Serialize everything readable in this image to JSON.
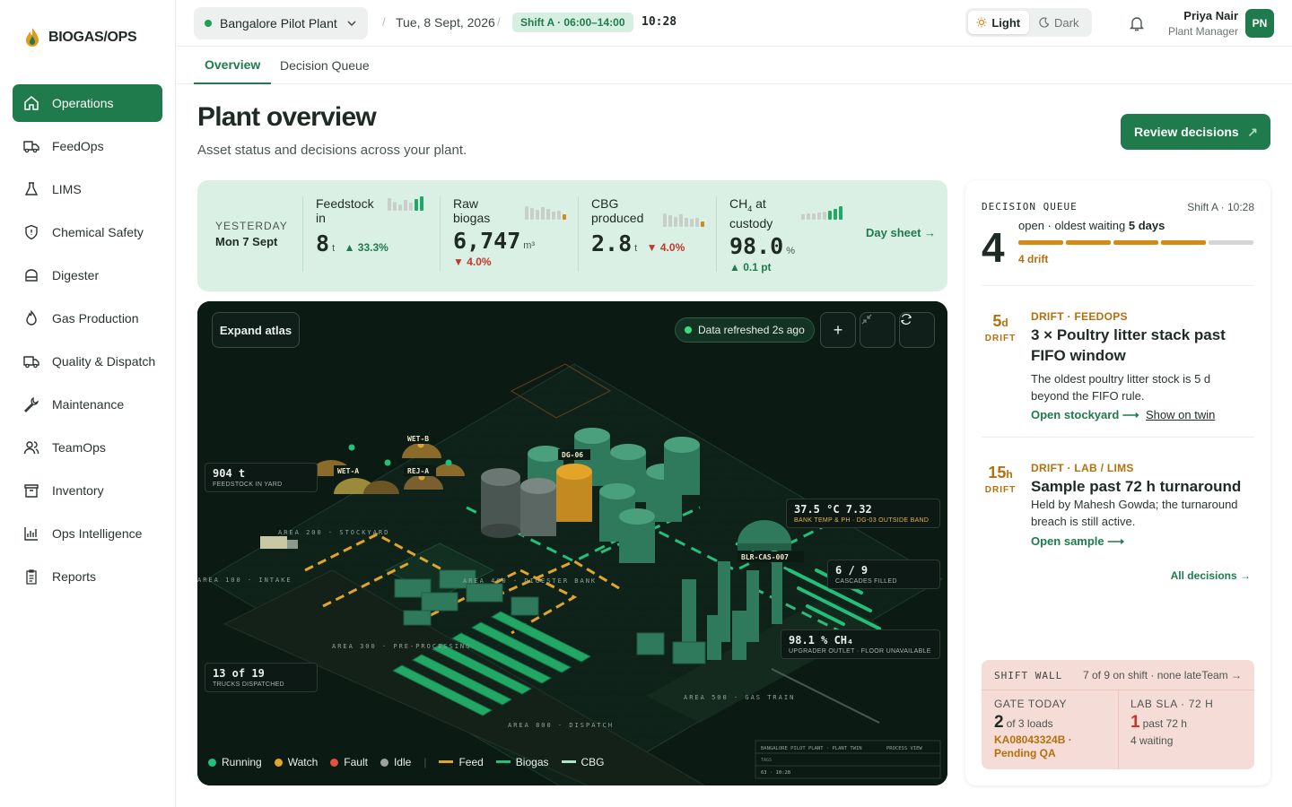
{
  "brand": {
    "name": "BIOGAS/OPS"
  },
  "sidebar": {
    "items": [
      {
        "label": "Operations",
        "icon": "home-icon"
      },
      {
        "label": "FeedOps",
        "icon": "truck-icon"
      },
      {
        "label": "LIMS",
        "icon": "flask-icon"
      },
      {
        "label": "Chemical Safety",
        "icon": "shield-icon"
      },
      {
        "label": "Digester",
        "icon": "tank-icon"
      },
      {
        "label": "Gas Production",
        "icon": "flame-icon"
      },
      {
        "label": "Quality & Dispatch",
        "icon": "delivery-truck-icon"
      },
      {
        "label": "Maintenance",
        "icon": "wrench-icon"
      },
      {
        "label": "TeamOps",
        "icon": "users-icon"
      },
      {
        "label": "Inventory",
        "icon": "archive-icon"
      },
      {
        "label": "Ops Intelligence",
        "icon": "chart-icon"
      },
      {
        "label": "Reports",
        "icon": "clipboard-icon"
      }
    ]
  },
  "topbar": {
    "plant": "Bangalore Pilot Plant",
    "date": "Tue, 8 Sept, 2026",
    "shift": "Shift A · 06:00–14:00",
    "clock": "10:28",
    "theme_light": "Light",
    "theme_dark": "Dark",
    "user_name": "Priya Nair",
    "user_role": "Plant Manager",
    "user_initials": "PN"
  },
  "tabs": [
    "Overview",
    "Decision Queue"
  ],
  "header": {
    "title": "Plant overview",
    "subtitle": "Asset status and decisions across your plant.",
    "review_button": "Review decisions"
  },
  "kpi": {
    "yesterday_label": "YESTERDAY",
    "yesterday_date": "Mon 7 Sept",
    "items": [
      {
        "label": "Feedstock in",
        "value": "8",
        "unit": "t",
        "delta": "▲ 33.3%",
        "dir": "up"
      },
      {
        "label": "Raw biogas",
        "value": "6,747",
        "unit": "m³",
        "delta": "▼ 4.0%",
        "dir": "down"
      },
      {
        "label": "CBG produced",
        "value": "2.8",
        "unit": "t",
        "delta": "▼ 4.0%",
        "dir": "down"
      },
      {
        "label_main": "CH",
        "label_sub": "4",
        "label_rest": " at custody",
        "value": "98.0",
        "unit": "%",
        "delta": "▲ 0.1 pt",
        "dir": "up"
      }
    ],
    "day_sheet": "Day sheet →"
  },
  "map": {
    "expand_button": "Expand atlas",
    "refreshed": "Data refreshed 2s ago",
    "callouts": {
      "feedstock": {
        "value": "904 t",
        "label": "FEEDSTOCK IN YARD"
      },
      "trucks": {
        "value": "13 of 19",
        "label": "TRUCKS DISPATCHED"
      },
      "bank": {
        "value": "37.5 °C 7.32",
        "label": "BANK TEMP & PH · DG-03 OUTSIDE BAND"
      },
      "cascades": {
        "value": "6 / 9",
        "label": "CASCADES FILLED"
      },
      "ch4": {
        "value": "98.1 % CH₄",
        "label": "UPGRADER OUTLET · FLOOR UNAVAILABLE"
      }
    },
    "areas": [
      "AREA 100 · INTAKE",
      "AREA 200 · STOCKYARD",
      "AREA 300 · PRE-PROCESSING",
      "AREA 400 · DIGESTER BANK",
      "AREA 500 · GAS TRAIN",
      "AREA 800 · DISPATCH"
    ],
    "asset_tags": [
      "WET-B",
      "WET-A",
      "REJ-A",
      "DG-06",
      "BLR-CAS-007"
    ],
    "plate": {
      "line1": "BANGALORE PILOT PLANT · PLANT TWIN",
      "line1b": "PROCESS VIEW",
      "line2": "TAGS",
      "line3": "63 · 10:28"
    },
    "legend": [
      {
        "label": "Running",
        "color": "#22c07a",
        "kind": "dot"
      },
      {
        "label": "Watch",
        "color": "#e2a52a",
        "kind": "dot"
      },
      {
        "label": "Fault",
        "color": "#e0533f",
        "kind": "dot"
      },
      {
        "label": "Idle",
        "color": "#9aa39e",
        "kind": "dot"
      },
      {
        "label": "Feed",
        "color": "#e2a52a",
        "kind": "line"
      },
      {
        "label": "Biogas",
        "color": "#22c07a",
        "kind": "line"
      },
      {
        "label": "CBG",
        "color": "#a8e6c7",
        "kind": "line"
      }
    ]
  },
  "queue": {
    "title": "DECISION QUEUE",
    "shift": "Shift A · 10:28",
    "count": "4",
    "open_text": "open · oldest waiting",
    "oldest": "5 days",
    "drift": "4 drift",
    "cards": [
      {
        "age": "5",
        "age_unit": "d",
        "drift_label": "DRIFT",
        "tag": "DRIFT · FEEDOPS",
        "title": "3 × Poultry litter stack past FIFO window",
        "desc": "The oldest poultry litter stock is 5 d beyond the FIFO rule.",
        "link": "Open stockyard ⟶",
        "link2": "Show on twin"
      },
      {
        "age": "15",
        "age_unit": "h",
        "drift_label": "DRIFT",
        "tag": "DRIFT · LAB / LIMS",
        "title": "Sample past 72 h turnaround",
        "desc": "Held by Mahesh Gowda; the turnaround breach is still active.",
        "link": "Open sample ⟶"
      }
    ],
    "all_link": "All decisions →",
    "wall": {
      "title": "SHIFT WALL",
      "summary": "7 of 9 on shift · none late",
      "team": "Team →",
      "gate_label": "GATE TODAY",
      "gate_num": "2",
      "gate_of": "of 3 loads",
      "gate_note": "KA08043324B · Pending QA",
      "lab_label": "LAB SLA · 72 H",
      "lab_num": "1",
      "lab_of": "past 72 h",
      "lab_note": "4 waiting"
    }
  },
  "colors": {
    "accent": "#1f7a4c",
    "warn": "#b4700c",
    "danger": "#c0392b",
    "map_bg": "#0c1a14"
  }
}
